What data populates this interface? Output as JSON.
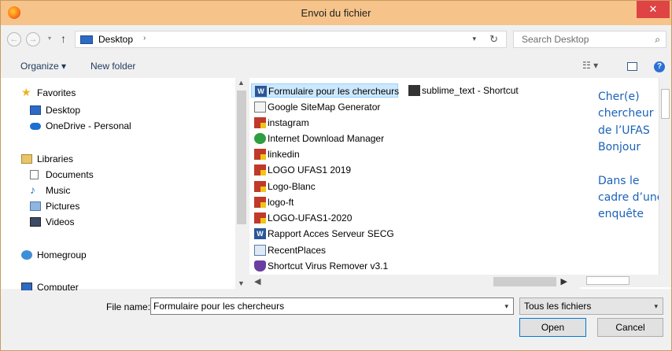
{
  "window": {
    "title": "Envoi du fichier",
    "close_glyph": "✕"
  },
  "address": {
    "path_label": "Desktop",
    "search_placeholder": "Search Desktop"
  },
  "toolbar": {
    "organize_label": "Organize ▾",
    "new_folder_label": "New folder"
  },
  "nav": {
    "favorites": "Favorites",
    "desktop": "Desktop",
    "onedrive": "OneDrive - Personal",
    "libraries": "Libraries",
    "documents": "Documents",
    "music": "Music",
    "pictures": "Pictures",
    "videos": "Videos",
    "homegroup": "Homegroup",
    "computer": "Computer"
  },
  "files": {
    "col1": [
      {
        "label": "Formulaire pour les chercheurs",
        "icon": "word-icon",
        "selected": true
      },
      {
        "label": "Google SiteMap Generator",
        "icon": "sitemap-icon"
      },
      {
        "label": "instagram",
        "icon": "image-icon"
      },
      {
        "label": "Internet Download Manager",
        "icon": "idm-icon"
      },
      {
        "label": "linkedin",
        "icon": "image-icon"
      },
      {
        "label": "LOGO UFAS1 2019",
        "icon": "image-icon"
      },
      {
        "label": "Logo-Blanc",
        "icon": "image-icon"
      },
      {
        "label": "logo-ft",
        "icon": "image-icon"
      },
      {
        "label": "LOGO-UFAS1-2020",
        "icon": "image-icon"
      },
      {
        "label": "Rapport Acces Serveur SECG",
        "icon": "word-icon"
      },
      {
        "label": "RecentPlaces",
        "icon": "recent-places-icon"
      },
      {
        "label": "Shortcut Virus Remover v3.1",
        "icon": "shield-icon"
      }
    ],
    "col2": [
      {
        "label": "sublime_text - Shortcut",
        "icon": "sublime-icon"
      }
    ]
  },
  "preview": {
    "text": "Cher(e) chercheur de l’UFAS Bonjour",
    "text2": "Dans le cadre d’une enquête"
  },
  "bottom": {
    "filename_label": "File name:",
    "filename_value": "Formulaire pour les chercheurs",
    "filter_value": "Tous les fichiers",
    "open_label": "Open",
    "cancel_label": "Cancel"
  }
}
